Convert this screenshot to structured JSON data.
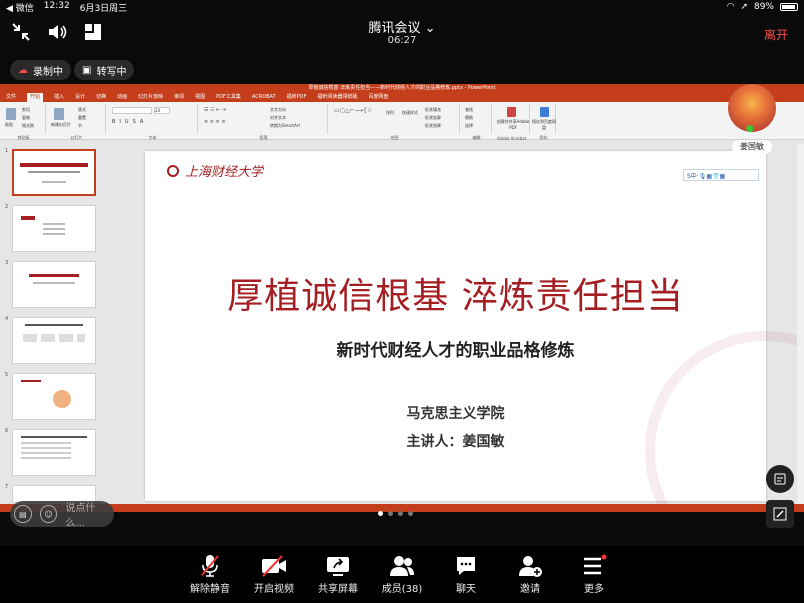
{
  "status": {
    "carrier": "◀ 微信",
    "time": "12:32",
    "date": "6月3日周三",
    "battery": "89%"
  },
  "meeting": {
    "title": "腾讯会议",
    "timer": "06:27",
    "leave": "离开",
    "recording": "录制中",
    "transcribing": "转写中"
  },
  "ppt": {
    "filename": "厚植诚信根基 淬炼责任担当——新时代财经人才的职业品格修炼.pptx - PowerPoint",
    "menus": [
      "文件",
      "开始",
      "插入",
      "设计",
      "切换",
      "动画",
      "幻灯片放映",
      "审阅",
      "视图",
      "PDF工具集",
      "ACROBAT",
      "福昕PDF",
      "福昕阅读器领鲜版",
      "百度网盘"
    ],
    "active_menu": "开始",
    "ribbon_groups": [
      "剪贴板",
      "幻灯片",
      "字体",
      "段落",
      "绘图",
      "编辑",
      "Adobe Acrobat",
      "保存"
    ],
    "ribbon_labels": {
      "paste": "粘贴",
      "new_slide": "新建幻灯片",
      "cut": "剪切",
      "copy": "复制",
      "format": "格式刷",
      "layout": "版式",
      "reset": "重置",
      "section": "节",
      "font_size": "24",
      "arrange": "排列",
      "quick_style": "快速样式",
      "find": "查找",
      "replace": "替换",
      "select": "选择",
      "pdf": "创建并共享Adobe PDF",
      "save_baidu": "保存到百度网盘",
      "shape_fill": "形状填充",
      "shape_outline": "形状轮廓",
      "shape_effect": "形状效果",
      "text_dir": "文字方向",
      "align_text": "对齐文本",
      "smartart": "转换为SmartArt"
    },
    "thumb_numbers": [
      "1",
      "2",
      "3",
      "4",
      "5",
      "6",
      "7"
    ],
    "slide": {
      "logo": "上海财经大学",
      "sogou": "S中·🎙▦👕▦",
      "title": "厚植诚信根基  淬炼责任担当",
      "subtitle": "新时代财经人才的职业品格修炼",
      "org": "马克思主义学院",
      "speaker": "主讲人：姜国敏"
    }
  },
  "participant": {
    "name": "姜国敏"
  },
  "comment": {
    "placeholder": "说点什么..."
  },
  "toolbar": [
    {
      "icon": "mic-muted-icon",
      "label": "解除静音"
    },
    {
      "icon": "video-off-icon",
      "label": "开启视频"
    },
    {
      "icon": "share-screen-icon",
      "label": "共享屏幕"
    },
    {
      "icon": "members-icon",
      "label": "成员(38)"
    },
    {
      "icon": "chat-icon",
      "label": "聊天"
    },
    {
      "icon": "invite-icon",
      "label": "邀请"
    },
    {
      "icon": "more-icon",
      "label": "更多"
    }
  ],
  "colors": {
    "accent_red": "#ff4a4a",
    "ppt_red": "#c43e1c",
    "title_red": "#a51e22"
  }
}
